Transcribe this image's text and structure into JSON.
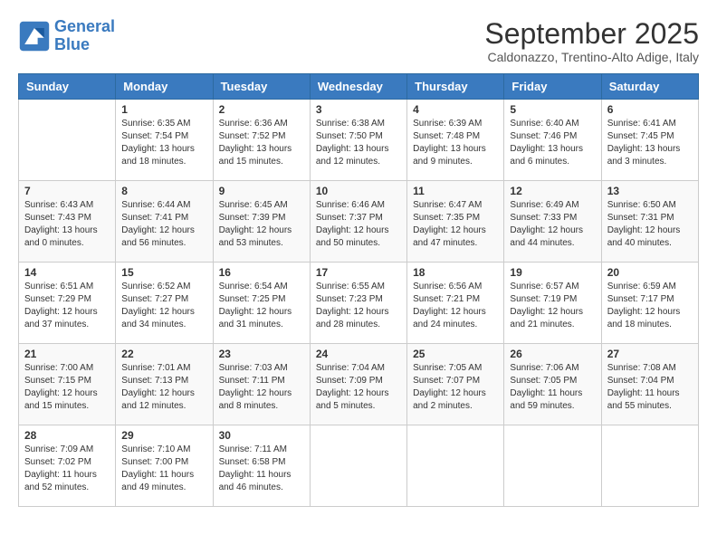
{
  "logo": {
    "line1": "General",
    "line2": "Blue"
  },
  "title": "September 2025",
  "location": "Caldonazzo, Trentino-Alto Adige, Italy",
  "days_of_week": [
    "Sunday",
    "Monday",
    "Tuesday",
    "Wednesday",
    "Thursday",
    "Friday",
    "Saturday"
  ],
  "weeks": [
    [
      {
        "day": "",
        "info": ""
      },
      {
        "day": "1",
        "info": "Sunrise: 6:35 AM\nSunset: 7:54 PM\nDaylight: 13 hours\nand 18 minutes."
      },
      {
        "day": "2",
        "info": "Sunrise: 6:36 AM\nSunset: 7:52 PM\nDaylight: 13 hours\nand 15 minutes."
      },
      {
        "day": "3",
        "info": "Sunrise: 6:38 AM\nSunset: 7:50 PM\nDaylight: 13 hours\nand 12 minutes."
      },
      {
        "day": "4",
        "info": "Sunrise: 6:39 AM\nSunset: 7:48 PM\nDaylight: 13 hours\nand 9 minutes."
      },
      {
        "day": "5",
        "info": "Sunrise: 6:40 AM\nSunset: 7:46 PM\nDaylight: 13 hours\nand 6 minutes."
      },
      {
        "day": "6",
        "info": "Sunrise: 6:41 AM\nSunset: 7:45 PM\nDaylight: 13 hours\nand 3 minutes."
      }
    ],
    [
      {
        "day": "7",
        "info": "Sunrise: 6:43 AM\nSunset: 7:43 PM\nDaylight: 13 hours\nand 0 minutes."
      },
      {
        "day": "8",
        "info": "Sunrise: 6:44 AM\nSunset: 7:41 PM\nDaylight: 12 hours\nand 56 minutes."
      },
      {
        "day": "9",
        "info": "Sunrise: 6:45 AM\nSunset: 7:39 PM\nDaylight: 12 hours\nand 53 minutes."
      },
      {
        "day": "10",
        "info": "Sunrise: 6:46 AM\nSunset: 7:37 PM\nDaylight: 12 hours\nand 50 minutes."
      },
      {
        "day": "11",
        "info": "Sunrise: 6:47 AM\nSunset: 7:35 PM\nDaylight: 12 hours\nand 47 minutes."
      },
      {
        "day": "12",
        "info": "Sunrise: 6:49 AM\nSunset: 7:33 PM\nDaylight: 12 hours\nand 44 minutes."
      },
      {
        "day": "13",
        "info": "Sunrise: 6:50 AM\nSunset: 7:31 PM\nDaylight: 12 hours\nand 40 minutes."
      }
    ],
    [
      {
        "day": "14",
        "info": "Sunrise: 6:51 AM\nSunset: 7:29 PM\nDaylight: 12 hours\nand 37 minutes."
      },
      {
        "day": "15",
        "info": "Sunrise: 6:52 AM\nSunset: 7:27 PM\nDaylight: 12 hours\nand 34 minutes."
      },
      {
        "day": "16",
        "info": "Sunrise: 6:54 AM\nSunset: 7:25 PM\nDaylight: 12 hours\nand 31 minutes."
      },
      {
        "day": "17",
        "info": "Sunrise: 6:55 AM\nSunset: 7:23 PM\nDaylight: 12 hours\nand 28 minutes."
      },
      {
        "day": "18",
        "info": "Sunrise: 6:56 AM\nSunset: 7:21 PM\nDaylight: 12 hours\nand 24 minutes."
      },
      {
        "day": "19",
        "info": "Sunrise: 6:57 AM\nSunset: 7:19 PM\nDaylight: 12 hours\nand 21 minutes."
      },
      {
        "day": "20",
        "info": "Sunrise: 6:59 AM\nSunset: 7:17 PM\nDaylight: 12 hours\nand 18 minutes."
      }
    ],
    [
      {
        "day": "21",
        "info": "Sunrise: 7:00 AM\nSunset: 7:15 PM\nDaylight: 12 hours\nand 15 minutes."
      },
      {
        "day": "22",
        "info": "Sunrise: 7:01 AM\nSunset: 7:13 PM\nDaylight: 12 hours\nand 12 minutes."
      },
      {
        "day": "23",
        "info": "Sunrise: 7:03 AM\nSunset: 7:11 PM\nDaylight: 12 hours\nand 8 minutes."
      },
      {
        "day": "24",
        "info": "Sunrise: 7:04 AM\nSunset: 7:09 PM\nDaylight: 12 hours\nand 5 minutes."
      },
      {
        "day": "25",
        "info": "Sunrise: 7:05 AM\nSunset: 7:07 PM\nDaylight: 12 hours\nand 2 minutes."
      },
      {
        "day": "26",
        "info": "Sunrise: 7:06 AM\nSunset: 7:05 PM\nDaylight: 11 hours\nand 59 minutes."
      },
      {
        "day": "27",
        "info": "Sunrise: 7:08 AM\nSunset: 7:04 PM\nDaylight: 11 hours\nand 55 minutes."
      }
    ],
    [
      {
        "day": "28",
        "info": "Sunrise: 7:09 AM\nSunset: 7:02 PM\nDaylight: 11 hours\nand 52 minutes."
      },
      {
        "day": "29",
        "info": "Sunrise: 7:10 AM\nSunset: 7:00 PM\nDaylight: 11 hours\nand 49 minutes."
      },
      {
        "day": "30",
        "info": "Sunrise: 7:11 AM\nSunset: 6:58 PM\nDaylight: 11 hours\nand 46 minutes."
      },
      {
        "day": "",
        "info": ""
      },
      {
        "day": "",
        "info": ""
      },
      {
        "day": "",
        "info": ""
      },
      {
        "day": "",
        "info": ""
      }
    ]
  ]
}
